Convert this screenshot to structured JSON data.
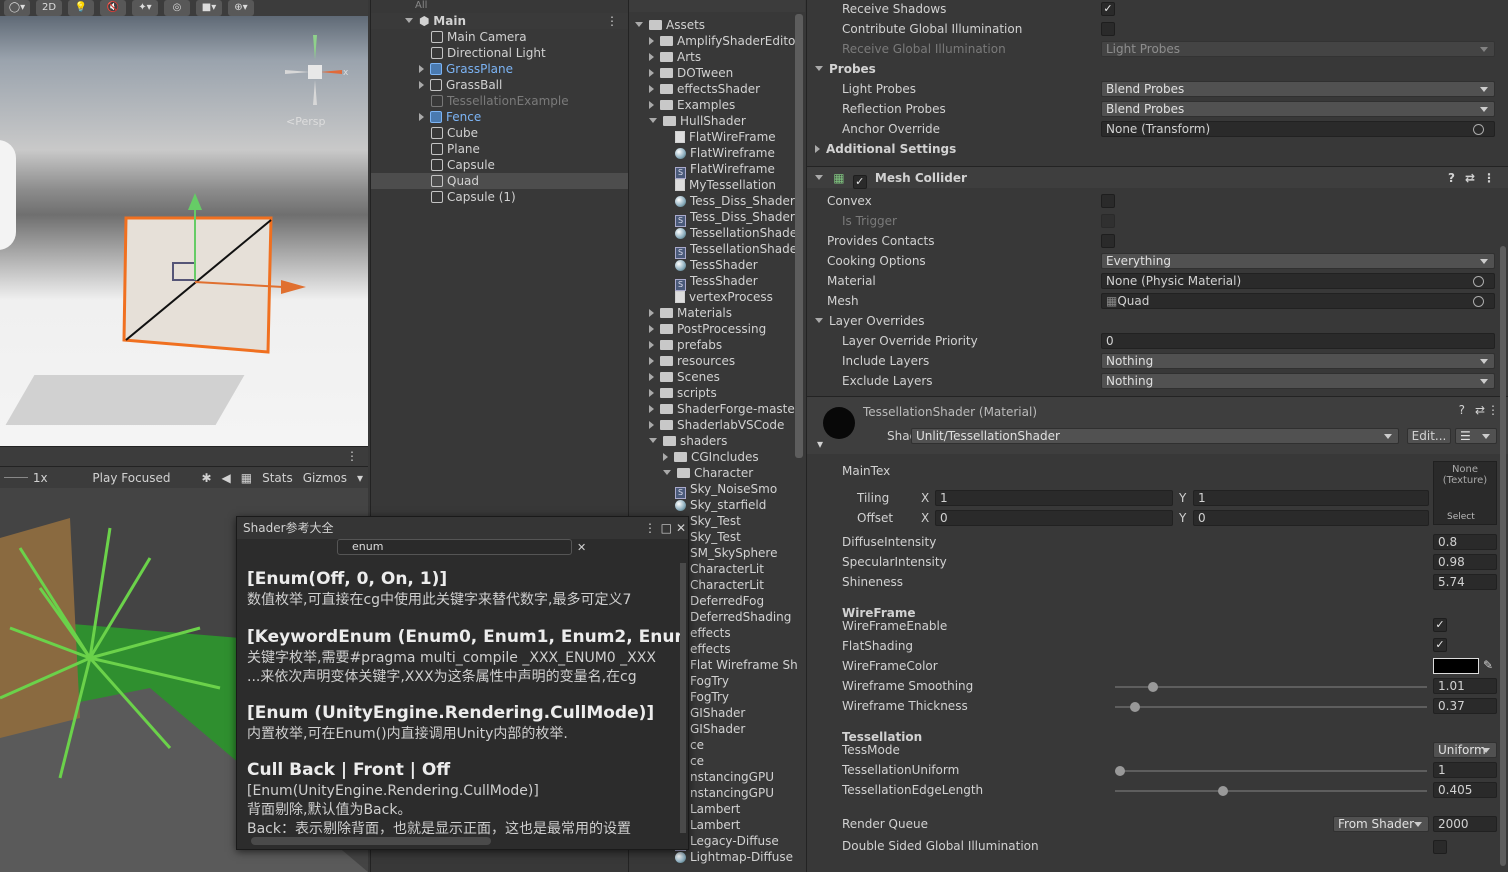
{
  "scene": {
    "toolbar": [
      "2D"
    ],
    "persp_label": "<Persp",
    "axis_x": "x"
  },
  "game_bar": {
    "scale": "1x",
    "play_mode": "Play Focused",
    "stats": "Stats",
    "gizmos": "Gizmos"
  },
  "hierarchy": {
    "search_placeholder": "All",
    "root": "Main",
    "items": [
      "Main Camera",
      "Directional Light",
      "GrassPlane",
      "GrassBall",
      "TessellationExample",
      "Fence",
      "Cube",
      "Plane",
      "Capsule",
      "Quad",
      "Capsule (1)"
    ]
  },
  "project": {
    "root": "Assets",
    "folders_top": [
      "AmplifyShaderEditor",
      "Arts",
      "DOTween",
      "effectsShader",
      "Examples",
      "HullShader"
    ],
    "hull_items": [
      "FlatWireFrame",
      "FlatWireframe",
      "FlatWireframe",
      "MyTessellation",
      "Tess_Diss_Shader",
      "Tess_Diss_Shader",
      "TessellationShade",
      "TessellationShade",
      "TessShader",
      "TessShader",
      "vertexProcess"
    ],
    "folders_mid": [
      "Materials",
      "PostProcessing",
      "prefabs",
      "resources",
      "Scenes",
      "scripts",
      "ShaderForge-master",
      "ShaderlabVSCode",
      "shaders"
    ],
    "shaders_sub": [
      "CGIncludes",
      "Character"
    ],
    "char_items": [
      "Sky_NoiseSmo",
      "Sky_starfield",
      "Sky_Test",
      "Sky_Test",
      "SM_SkySphere",
      "CharacterLit",
      "CharacterLit",
      "DeferredFog",
      "DeferredShading",
      "effects",
      "effects",
      "Flat Wireframe Sh",
      "FogTry",
      "FogTry",
      "GIShader",
      "GIShader",
      "ce",
      "ce",
      "nstancingGPU",
      "nstancingGPU",
      "Lambert",
      "Lambert",
      "Legacy-Diffuse",
      "Lightmap-Diffuse"
    ]
  },
  "popup": {
    "title": "Shader参考大全",
    "search_value": "enum",
    "entries": [
      {
        "title": "[Enum(Off, 0, On, 1)]",
        "lines": [
          "数值枚举,可直接在cg中使用此关键字来替代数字,最多可定义7"
        ]
      },
      {
        "title": "[KeywordEnum (Enum0, Enum1, Enum2, Enum3, En",
        "lines": [
          "关键字枚举,需要#pragma multi_compile _XXX_ENUM0 _XXX",
          "...来依次声明变体关键字,XXX为这条属性中声明的变量名,在cg"
        ]
      },
      {
        "title": "[Enum (UnityEngine.Rendering.CullMode)]",
        "lines": [
          "内置枚举,可在Enum()内直接调用Unity内部的枚举."
        ]
      },
      {
        "title": "Cull Back | Front | Off",
        "lines": [
          "[Enum(UnityEngine.Rendering.CullMode)]",
          "背面剔除,默认值为Back。",
          "Back：表示剔除背面，也就是显示正面，这也是最常用的设置"
        ]
      }
    ]
  },
  "inspector": {
    "renderer_rows": [
      {
        "label": "Receive Shadows",
        "type": "check",
        "value": "✓"
      },
      {
        "label": "Contribute Global Illumination",
        "type": "check",
        "value": ""
      },
      {
        "label": "Receive Global Illumination",
        "type": "dropdim",
        "value": "Light Probes"
      }
    ],
    "probes_header": "Probes",
    "probes_rows": [
      {
        "label": "Light Probes",
        "value": "Blend Probes"
      },
      {
        "label": "Reflection Probes",
        "value": "Blend Probes"
      },
      {
        "label": "Anchor Override",
        "value": "None (Transform)"
      }
    ],
    "additional": "Additional Settings",
    "collider_title": "Mesh Collider",
    "collider": {
      "convex": "Convex",
      "is_trigger": "Is Trigger",
      "contacts": "Provides Contacts",
      "cooking": "Cooking Options",
      "cooking_value": "Everything",
      "material": "Material",
      "material_value": "None (Physic Material)",
      "mesh": "Mesh",
      "mesh_value": "Quad",
      "layer_overrides": "Layer Overrides",
      "priority": "Layer Override Priority",
      "priority_value": "0",
      "include": "Include Layers",
      "include_value": "Nothing",
      "exclude": "Exclude Layers",
      "exclude_value": "Nothing"
    },
    "material": {
      "title": "TessellationShader (Material)",
      "shader_label": "Shader",
      "shader_value": "Unlit/TessellationShader",
      "edit": "Edit...",
      "maintex": "MainTex",
      "tex_none": "None\n(Texture)",
      "tex_select": "Select",
      "tiling": "Tiling",
      "offset": "Offset",
      "x": "X",
      "y": "Y",
      "tiling_x": "1",
      "tiling_y": "1",
      "offset_x": "0",
      "offset_y": "0",
      "floats": [
        {
          "label": "DiffuseIntensity",
          "value": "0.8"
        },
        {
          "label": "SpecularIntensity",
          "value": "0.98"
        },
        {
          "label": "Shineness",
          "value": "5.74"
        }
      ],
      "wire_header": "WireFrame",
      "wire_enable": "WireFrameEnable",
      "flat": "FlatShading",
      "wire_color": "WireFrameColor",
      "wire_color_hex": "#000000",
      "sliders": [
        {
          "label": "Wireframe Smoothing",
          "value": "1.01",
          "frac": 0.11
        },
        {
          "label": "Wireframe Thickness",
          "value": "0.37",
          "frac": 0.05
        }
      ],
      "tess_header": "Tessellation",
      "tess_mode": "TessMode",
      "tess_mode_value": "Uniform",
      "tess_sliders": [
        {
          "label": "TessellationUniform",
          "value": "1",
          "frac": 0.0
        },
        {
          "label": "TessellationEdgeLength",
          "value": "0.405",
          "frac": 0.34
        }
      ],
      "render_queue": "Render Queue",
      "rq_mode": "From Shader",
      "rq_value": "2000",
      "double_sided": "Double Sided Global Illumination"
    }
  }
}
